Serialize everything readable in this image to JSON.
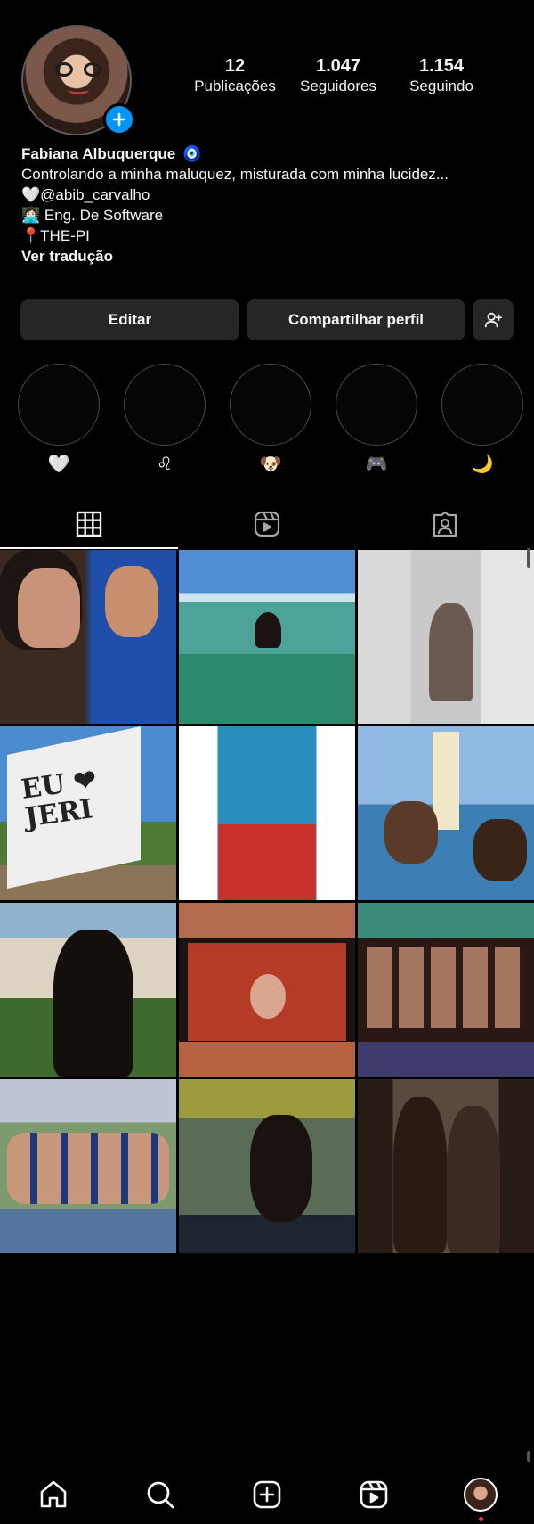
{
  "profile": {
    "name": "Fabiana Albuquerque",
    "name_emoji": "🧿",
    "stats": [
      {
        "value": "12",
        "label": "Publicações"
      },
      {
        "value": "1.047",
        "label": "Seguidores"
      },
      {
        "value": "1.154",
        "label": "Seguindo"
      }
    ],
    "bio_lines": [
      "Controlando a minha maluquez, misturada com minha lucidez...",
      "🤍@abib_carvalho",
      "👩🏻‍💻 Eng. De Software",
      "📍THE-PI"
    ],
    "translate_label": "Ver tradução"
  },
  "actions": {
    "edit_label": "Editar",
    "share_label": "Compartilhar perfil"
  },
  "highlights": [
    {
      "emoji": "🤍"
    },
    {
      "emoji": "♌"
    },
    {
      "emoji": "🐶"
    },
    {
      "emoji": "🎮"
    },
    {
      "emoji": "🌙"
    }
  ],
  "tabs": [
    {
      "name": "posts",
      "icon": "grid-icon",
      "active": true
    },
    {
      "name": "reels",
      "icon": "reels-icon",
      "active": false
    },
    {
      "name": "tagged",
      "icon": "tagged-icon",
      "active": false
    }
  ],
  "post_texts": {
    "sail": "EU ❤\nJERI"
  },
  "bottom_nav": [
    {
      "name": "home",
      "icon": "home-icon"
    },
    {
      "name": "search",
      "icon": "search-icon"
    },
    {
      "name": "create",
      "icon": "plus-square-icon"
    },
    {
      "name": "reels",
      "icon": "reels-icon"
    },
    {
      "name": "profile",
      "icon": "avatar"
    }
  ],
  "colors": {
    "background": "#000000",
    "button": "#262626",
    "accent": "#0095f6",
    "notification_dot": "#ff3040"
  }
}
